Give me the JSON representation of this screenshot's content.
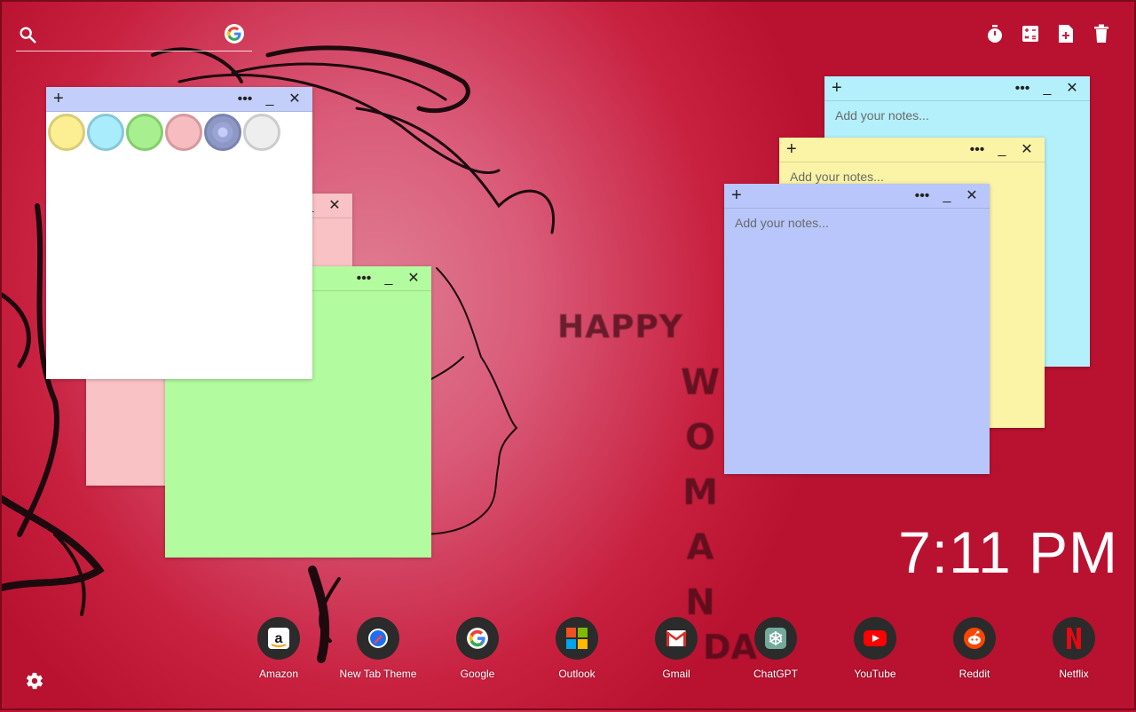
{
  "search": {
    "placeholder": "",
    "icon": "search-icon",
    "engine_icon": "google-icon"
  },
  "toolbar": {
    "icons": [
      "timer-icon",
      "calculator-icon",
      "new-note-icon",
      "trash-icon"
    ]
  },
  "background_text": {
    "happy": "HAPPY",
    "woman": [
      "W",
      "O",
      "M",
      "A",
      "N"
    ],
    "day": "DA"
  },
  "notes": {
    "placeholder": "Add your notes...",
    "plus": "+",
    "more": "•••",
    "minimize": "_",
    "close": "✕"
  },
  "colors": {
    "note_cyan": "#b3f0fb",
    "note_yellow": "#fbf3a6",
    "note_blue": "#b8c6fb",
    "note_pink": "#f9c2c4",
    "note_green": "#b2fb9e",
    "note_white": "#ffffff",
    "swatch_yellow": "#fbee93",
    "swatch_cyan": "#a9ecfb",
    "swatch_green": "#a8f08f",
    "swatch_pink": "#f7bcc0",
    "swatch_blue": "#8e98c4",
    "swatch_white": "#eeeeee",
    "header_blue": "#c4cefb"
  },
  "clock": {
    "time": "7:11 PM"
  },
  "dock": [
    {
      "label": "Amazon",
      "icon": "amazon-icon"
    },
    {
      "label": "New Tab Theme",
      "icon": "new-tab-theme-icon"
    },
    {
      "label": "Google",
      "icon": "google-icon"
    },
    {
      "label": "Outlook",
      "icon": "outlook-icon"
    },
    {
      "label": "Gmail",
      "icon": "gmail-icon"
    },
    {
      "label": "ChatGPT",
      "icon": "chatgpt-icon"
    },
    {
      "label": "YouTube",
      "icon": "youtube-icon"
    },
    {
      "label": "Reddit",
      "icon": "reddit-icon"
    },
    {
      "label": "Netflix",
      "icon": "netflix-icon"
    }
  ],
  "settings": {
    "icon": "gear-icon"
  }
}
